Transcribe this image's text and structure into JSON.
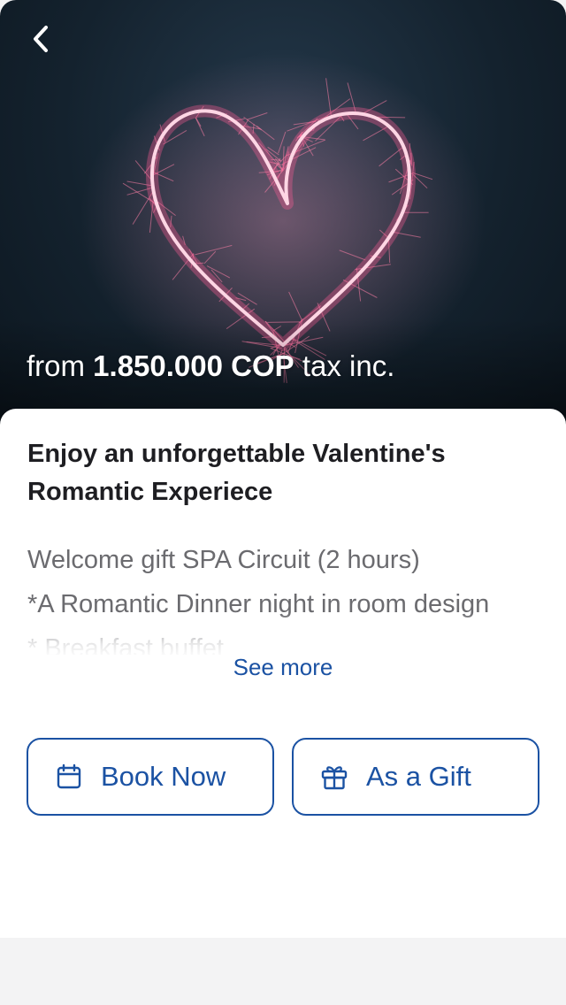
{
  "hero": {
    "back_icon": "chevron-left-icon",
    "price_prefix": "from",
    "price_amount": "1.850.000 COP",
    "price_suffix": "tax inc."
  },
  "offer": {
    "title_line1": "Enjoy an unforgettable  Valentine's",
    "title_line2": "Romantic Experiece",
    "description": [
      "Welcome gift SPA Circuit (2 hours)",
      "*A Romantic Dinner night in room design",
      "* Breakfast buffet"
    ],
    "see_more_label": "See more"
  },
  "actions": {
    "book_icon": "calendar-icon",
    "book_label": "Book Now",
    "gift_icon": "gift-icon",
    "gift_label": "As a Gift"
  },
  "colors": {
    "accent": "#1b52a3",
    "title_text": "#1e1e22",
    "body_text": "#6b6b6f",
    "hero_background": "#14222e",
    "sparkler": "#ff7fa8",
    "page_background": "#f3f3f4"
  }
}
